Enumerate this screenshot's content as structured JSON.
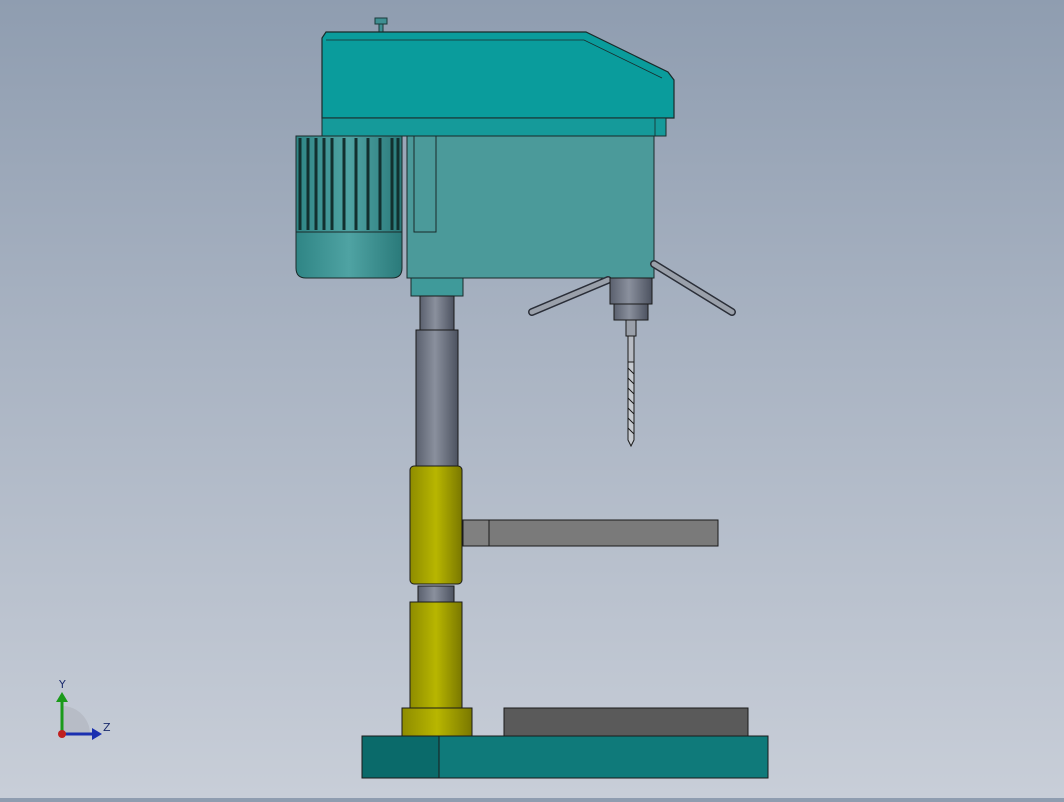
{
  "triad": {
    "y_label": "Y",
    "z_label": "Z",
    "colors": {
      "y": "#1a9a1a",
      "z": "#1a2fb0",
      "x": "#c02020"
    }
  },
  "model": {
    "head_color": "#0a9c9c",
    "motor_color": "#4a9a9a",
    "column_color": "#6f7685",
    "collar_color": "#a8a600",
    "table_color": "#7a7a7a",
    "base_color": "#0d7373"
  }
}
